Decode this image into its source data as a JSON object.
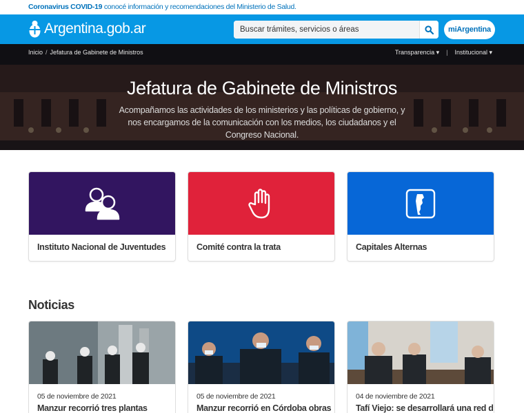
{
  "covid": {
    "strong": "Coronavirus COVID-19",
    "text": " conocé información y recomendaciones del Ministerio de Salud."
  },
  "header": {
    "logo_text": "Argentina.gob.ar",
    "search_placeholder": "Buscar trámites, servicios o áreas",
    "miargentina_label": "miArgentina"
  },
  "breadcrumb": {
    "home": "Inicio",
    "separator": "/",
    "current": "Jefatura de Gabinete de Ministros"
  },
  "topnav": {
    "transparencia": "Transparencia ▾",
    "divider": "|",
    "institucional": "Institucional ▾"
  },
  "hero": {
    "title": "Jefatura de Gabinete de Ministros",
    "description": "Acompañamos las actividades de los ministerios y las políticas de gobierno, y nos encargamos de la comunicación con los medios, los ciudadanos y el Congreso Nacional."
  },
  "cards": [
    {
      "label": "Instituto Nacional de Juventudes",
      "icon": "people-icon",
      "color": "#321560"
    },
    {
      "label": "Comité contra la trata",
      "icon": "hand-stop-icon",
      "color": "#e0223a"
    },
    {
      "label": "Capitales Alternas",
      "icon": "argentina-map-icon",
      "color": "#0767d7"
    }
  ],
  "noticias": {
    "title": "Noticias",
    "items": [
      {
        "date": "05 de noviembre de 2021",
        "headline": "Manzur recorrió tres plantas"
      },
      {
        "date": "05 de noviembre de 2021",
        "headline": "Manzur recorrió en Córdoba obras"
      },
      {
        "date": "04 de noviembre de 2021",
        "headline": "Tafí Viejo: se desarrollará una red de"
      }
    ]
  },
  "colors": {
    "brand_blue": "#0798e4",
    "link_blue": "#0072bb"
  }
}
